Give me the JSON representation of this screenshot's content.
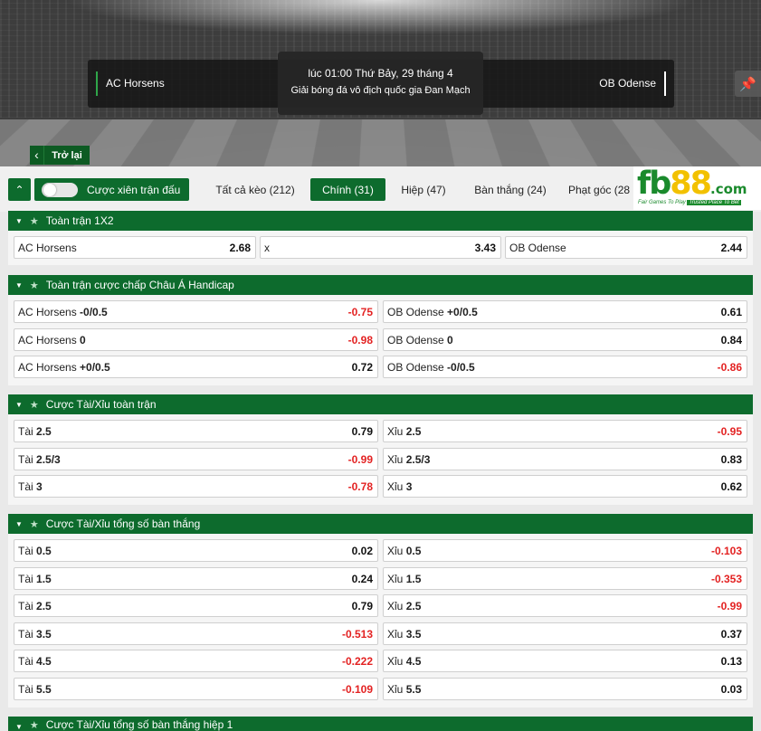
{
  "header": {
    "home_team": "AC Horsens",
    "away_team": "OB Odense",
    "match_time": "lúc 01:00 Thứ Bảy, 29 tháng 4",
    "league": "Giải bóng đá vô địch quốc gia Đan Mạch",
    "back_label": "Trở lại",
    "pin_icon": "pin-icon"
  },
  "filters": {
    "parlay_label": "Cược xiên trận đấu",
    "parlay_on": false,
    "tabs": [
      {
        "label": "Tất cả kèo (212)",
        "active": false
      },
      {
        "label": "Chính (31)",
        "active": true
      },
      {
        "label": "Hiệp (47)",
        "active": false
      },
      {
        "label": "Bàn thắng (24)",
        "active": false
      },
      {
        "label": "Phạt góc (28",
        "active": false
      }
    ]
  },
  "logo": {
    "fb": "fb",
    "n88": "88",
    "com": ".com",
    "tag_left": "Fair Games To Play",
    "tag_right": "Trusted Place To Bet"
  },
  "markets": [
    {
      "title": "Toàn trận 1X2",
      "columns": 3,
      "rows": [
        [
          {
            "name": "AC Horsens",
            "line": "",
            "odds": "2.68"
          },
          {
            "name": "x",
            "line": "",
            "odds": "3.43"
          },
          {
            "name": "OB Odense",
            "line": "",
            "odds": "2.44"
          }
        ]
      ]
    },
    {
      "title": "Toàn trận cược chấp Châu Á Handicap",
      "columns": 2,
      "rows": [
        [
          {
            "name": "AC Horsens",
            "line": "-0/0.5",
            "odds": "-0.75"
          },
          {
            "name": "OB Odense",
            "line": "+0/0.5",
            "odds": "0.61"
          }
        ],
        [
          {
            "name": "AC Horsens",
            "line": "0",
            "odds": "-0.98"
          },
          {
            "name": "OB Odense",
            "line": "0",
            "odds": "0.84"
          }
        ],
        [
          {
            "name": "AC Horsens",
            "line": "+0/0.5",
            "odds": "0.72"
          },
          {
            "name": "OB Odense",
            "line": "-0/0.5",
            "odds": "-0.86"
          }
        ]
      ]
    },
    {
      "title": "Cược Tài/Xỉu toàn trận",
      "columns": 2,
      "rows": [
        [
          {
            "name": "Tài",
            "line": "2.5",
            "odds": "0.79"
          },
          {
            "name": "Xỉu",
            "line": "2.5",
            "odds": "-0.95"
          }
        ],
        [
          {
            "name": "Tài",
            "line": "2.5/3",
            "odds": "-0.99"
          },
          {
            "name": "Xỉu",
            "line": "2.5/3",
            "odds": "0.83"
          }
        ],
        [
          {
            "name": "Tài",
            "line": "3",
            "odds": "-0.78"
          },
          {
            "name": "Xỉu",
            "line": "3",
            "odds": "0.62"
          }
        ]
      ]
    },
    {
      "title": "Cược Tài/Xỉu tổng số bàn thắng",
      "columns": 2,
      "rows": [
        [
          {
            "name": "Tài",
            "line": "0.5",
            "odds": "0.02"
          },
          {
            "name": "Xỉu",
            "line": "0.5",
            "odds": "-0.103"
          }
        ],
        [
          {
            "name": "Tài",
            "line": "1.5",
            "odds": "0.24"
          },
          {
            "name": "Xỉu",
            "line": "1.5",
            "odds": "-0.353"
          }
        ],
        [
          {
            "name": "Tài",
            "line": "2.5",
            "odds": "0.79"
          },
          {
            "name": "Xỉu",
            "line": "2.5",
            "odds": "-0.99"
          }
        ],
        [
          {
            "name": "Tài",
            "line": "3.5",
            "odds": "-0.513"
          },
          {
            "name": "Xỉu",
            "line": "3.5",
            "odds": "0.37"
          }
        ],
        [
          {
            "name": "Tài",
            "line": "4.5",
            "odds": "-0.222"
          },
          {
            "name": "Xỉu",
            "line": "4.5",
            "odds": "0.13"
          }
        ],
        [
          {
            "name": "Tài",
            "line": "5.5",
            "odds": "-0.109"
          },
          {
            "name": "Xỉu",
            "line": "5.5",
            "odds": "0.03"
          }
        ]
      ]
    },
    {
      "title": "Cược Tài/Xỉu tổng số bàn thắng hiệp 1",
      "columns": 2,
      "rows": []
    }
  ],
  "colors": {
    "brand_green": "#0d6b2d",
    "negative_odds": "#e32222",
    "logo_yellow": "#f2c100"
  }
}
